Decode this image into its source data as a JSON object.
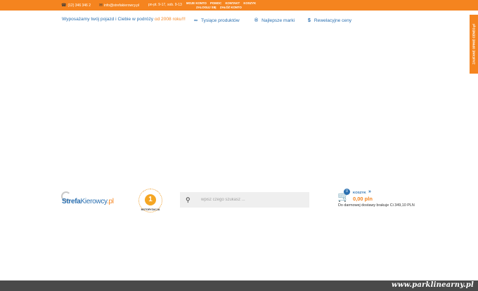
{
  "topbar": {
    "phone": "(12) 346 346 2",
    "email": "info@strefakierowcy.pl",
    "hours": "pn-pt. 9-17, sob. 9-13",
    "menu": {
      "account": "MOJE KONTO",
      "help": "POMOC",
      "contact": "KONTAKT",
      "cart": "KOSZYK",
      "login": "ZALOGUJ SIĘ",
      "register": "ZAŁÓŻ KONTO"
    },
    "colors": {
      "background": "#f5841f"
    }
  },
  "tagline": {
    "text": "Wyposażamy twój pojazd i Ciebie w podróży ",
    "since": "od 2008 roku!!!"
  },
  "features": [
    {
      "icon": "link-icon",
      "label": "Tysiące produktów"
    },
    {
      "icon": "registered-icon",
      "label": "Najlepsze marki"
    },
    {
      "icon": "dollar-icon",
      "label": "Rewelacyjne ceny"
    }
  ],
  "side_tab": {
    "label": "ZAUFANE OPINIE CENEO.pl"
  },
  "logo": {
    "part1": "Strefa",
    "part2": "Kierowcy",
    "part3": ".pl"
  },
  "badge": {
    "number": "1",
    "caption": "MOTORYZACJA"
  },
  "search": {
    "placeholder": "wpisz czego szukasz ...",
    "icon": "search-icon"
  },
  "cart": {
    "count": "0",
    "label": "KOSZYK",
    "price": "0,00 pln",
    "shipping_note": "Do darmowej dostawy brakuje Ci 349,10 PLN"
  },
  "watermark": "www.parklinearny.pl",
  "colors": {
    "accent": "#f5841f",
    "brand_blue": "#2a6fb0",
    "footer": "#4a4a4a"
  }
}
